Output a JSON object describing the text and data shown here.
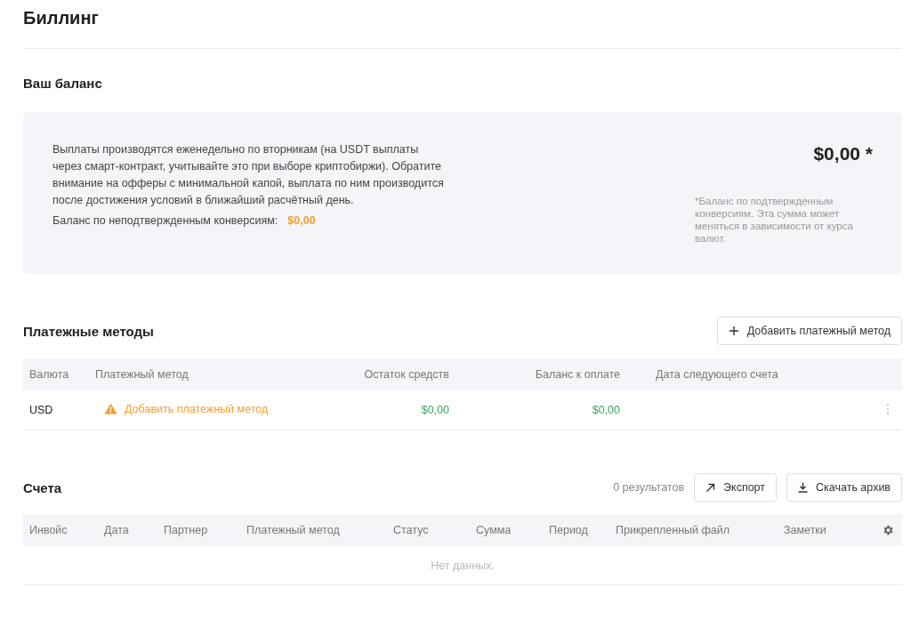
{
  "page_title": "Биллинг",
  "balance": {
    "heading": "Ваш баланс",
    "info": "Выплаты производятся еженедельно по вторникам (на USDT выплаты через смарт-контракт, учитывайте это при выборе криптобиржи). Обратите внимание на офферы с минимальной капой, выплата по ним производится после достижения условий в ближайший расчётный день.",
    "unconfirmed_label": "Баланс по неподтвержденным конверсиям:",
    "unconfirmed_value": "$0,00",
    "amount": "$0,00 *",
    "note": "*Баланс по подтвержденным конверсиям. Эта сумма может меняться в зависимости от курса валют."
  },
  "payment_methods": {
    "heading": "Платежные методы",
    "add_button": "Добавить платежный метод",
    "columns": [
      "Валюта",
      "Платежный метод",
      "Остаток средств",
      "Баланс к оплате",
      "Дата следующего счета"
    ],
    "rows": [
      {
        "currency": "USD",
        "method": "Добавить платежный метод",
        "method_warning": true,
        "funds": "$0,00",
        "payable": "$0,00"
      }
    ]
  },
  "invoices": {
    "heading": "Счета",
    "results": "0 результатов",
    "export_button": "Экспорт",
    "archive_button": "Скачать архив",
    "columns": [
      "Инвойс",
      "Дата",
      "Партнер",
      "Платежный метод",
      "Статус",
      "Сумма",
      "Период",
      "Прикрепленный файл",
      "Заметки"
    ],
    "empty": "Нет данных."
  }
}
